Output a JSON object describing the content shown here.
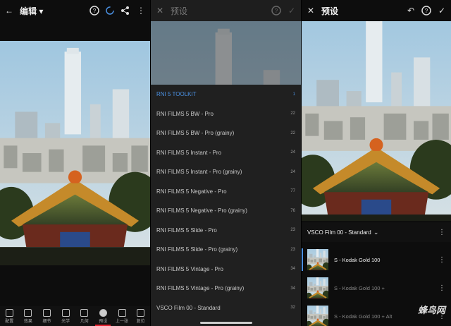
{
  "panel1": {
    "title": "编辑",
    "toolbar": [
      {
        "label": "配置"
      },
      {
        "label": "效果"
      },
      {
        "label": "细节"
      },
      {
        "label": "光学"
      },
      {
        "label": "几何"
      },
      {
        "label": "预设",
        "active": true
      },
      {
        "label": "上一张"
      },
      {
        "label": "复位"
      }
    ]
  },
  "panel2": {
    "title": "预设",
    "presets": [
      {
        "name": "RNI 5 TOOLKIT",
        "count": "1",
        "highlight": true
      },
      {
        "name": "RNI FILMS 5 BW - Pro",
        "count": "22"
      },
      {
        "name": "RNI FILMS 5 BW - Pro (grainy)",
        "count": "22"
      },
      {
        "name": "RNI FILMS 5 Instant - Pro",
        "count": "24"
      },
      {
        "name": "RNI FILMS 5 Instant - Pro (grainy)",
        "count": "24"
      },
      {
        "name": "RNI FILMS 5 Negative - Pro",
        "count": "77"
      },
      {
        "name": "RNI FILMS 5 Negative - Pro (grainy)",
        "count": "76"
      },
      {
        "name": "RNI FILMS 5 Slide - Pro",
        "count": "23"
      },
      {
        "name": "RNI FILMS 5 Slide - Pro (grainy)",
        "count": "23"
      },
      {
        "name": "RNI FILMS 5 Vintage - Pro",
        "count": "34"
      },
      {
        "name": "RNI FILMS 5 Vintage - Pro (grainy)",
        "count": "34"
      },
      {
        "name": "VSCO Film 00 - Standard",
        "count": "32"
      }
    ]
  },
  "panel3": {
    "title": "预设",
    "group": "VSCO Film 00 - Standard",
    "items": [
      {
        "name": "S - Kodak Gold 100",
        "selected": true
      },
      {
        "name": "S - Kodak Gold 100 +"
      },
      {
        "name": "S - Kodak Gold 100 + Alt"
      }
    ],
    "watermark": "蜂鸟网"
  },
  "colors": {
    "accent": "#4a90e2",
    "active_tab": "#e5202e"
  }
}
